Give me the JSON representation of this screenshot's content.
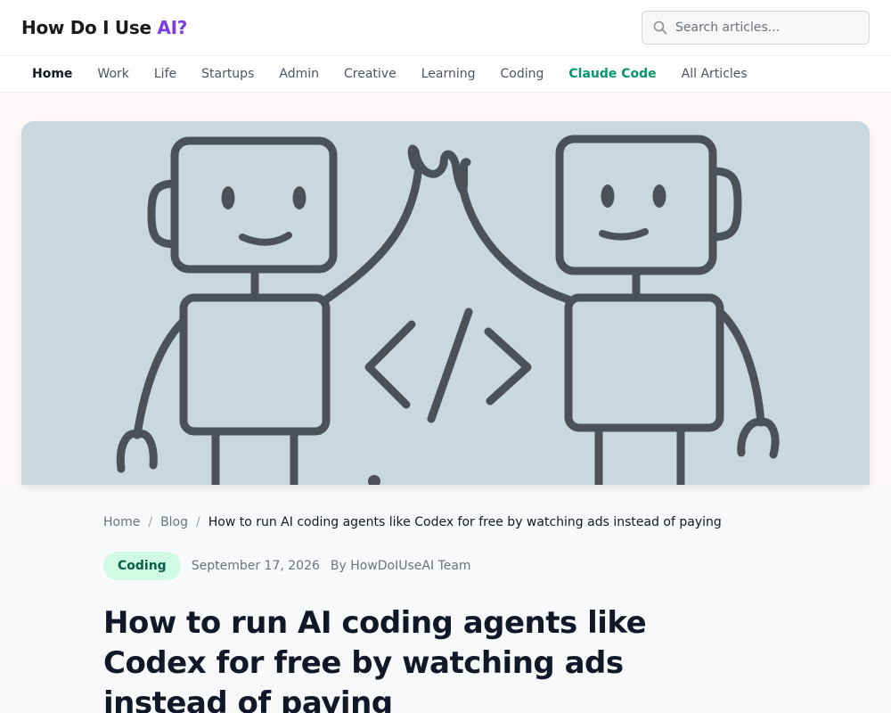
{
  "header": {
    "logo_main": "How Do I Use ",
    "logo_accent": "AI?",
    "search_placeholder": "Search articles..."
  },
  "nav": {
    "items": [
      {
        "label": "Home"
      },
      {
        "label": "Work"
      },
      {
        "label": "Life"
      },
      {
        "label": "Startups"
      },
      {
        "label": "Admin"
      },
      {
        "label": "Creative"
      },
      {
        "label": "Learning"
      },
      {
        "label": "Coding"
      },
      {
        "label": "Claude Code"
      },
      {
        "label": "All Articles"
      }
    ]
  },
  "breadcrumb": {
    "home": "Home",
    "separator": "/",
    "blog": "Blog",
    "current": "How to run AI coding agents like Codex for free by watching ads instead of paying"
  },
  "article": {
    "category": "Coding",
    "date": "September 17, 2026",
    "author": "By HowDoIUseAI Team",
    "title": "How to run AI coding agents like Codex for free by watching ads instead of paying"
  },
  "colors": {
    "accent": "#7c3aed",
    "featured": "#059669",
    "badge_bg": "#d1fae5",
    "hero_bg": "#c9d7df"
  }
}
